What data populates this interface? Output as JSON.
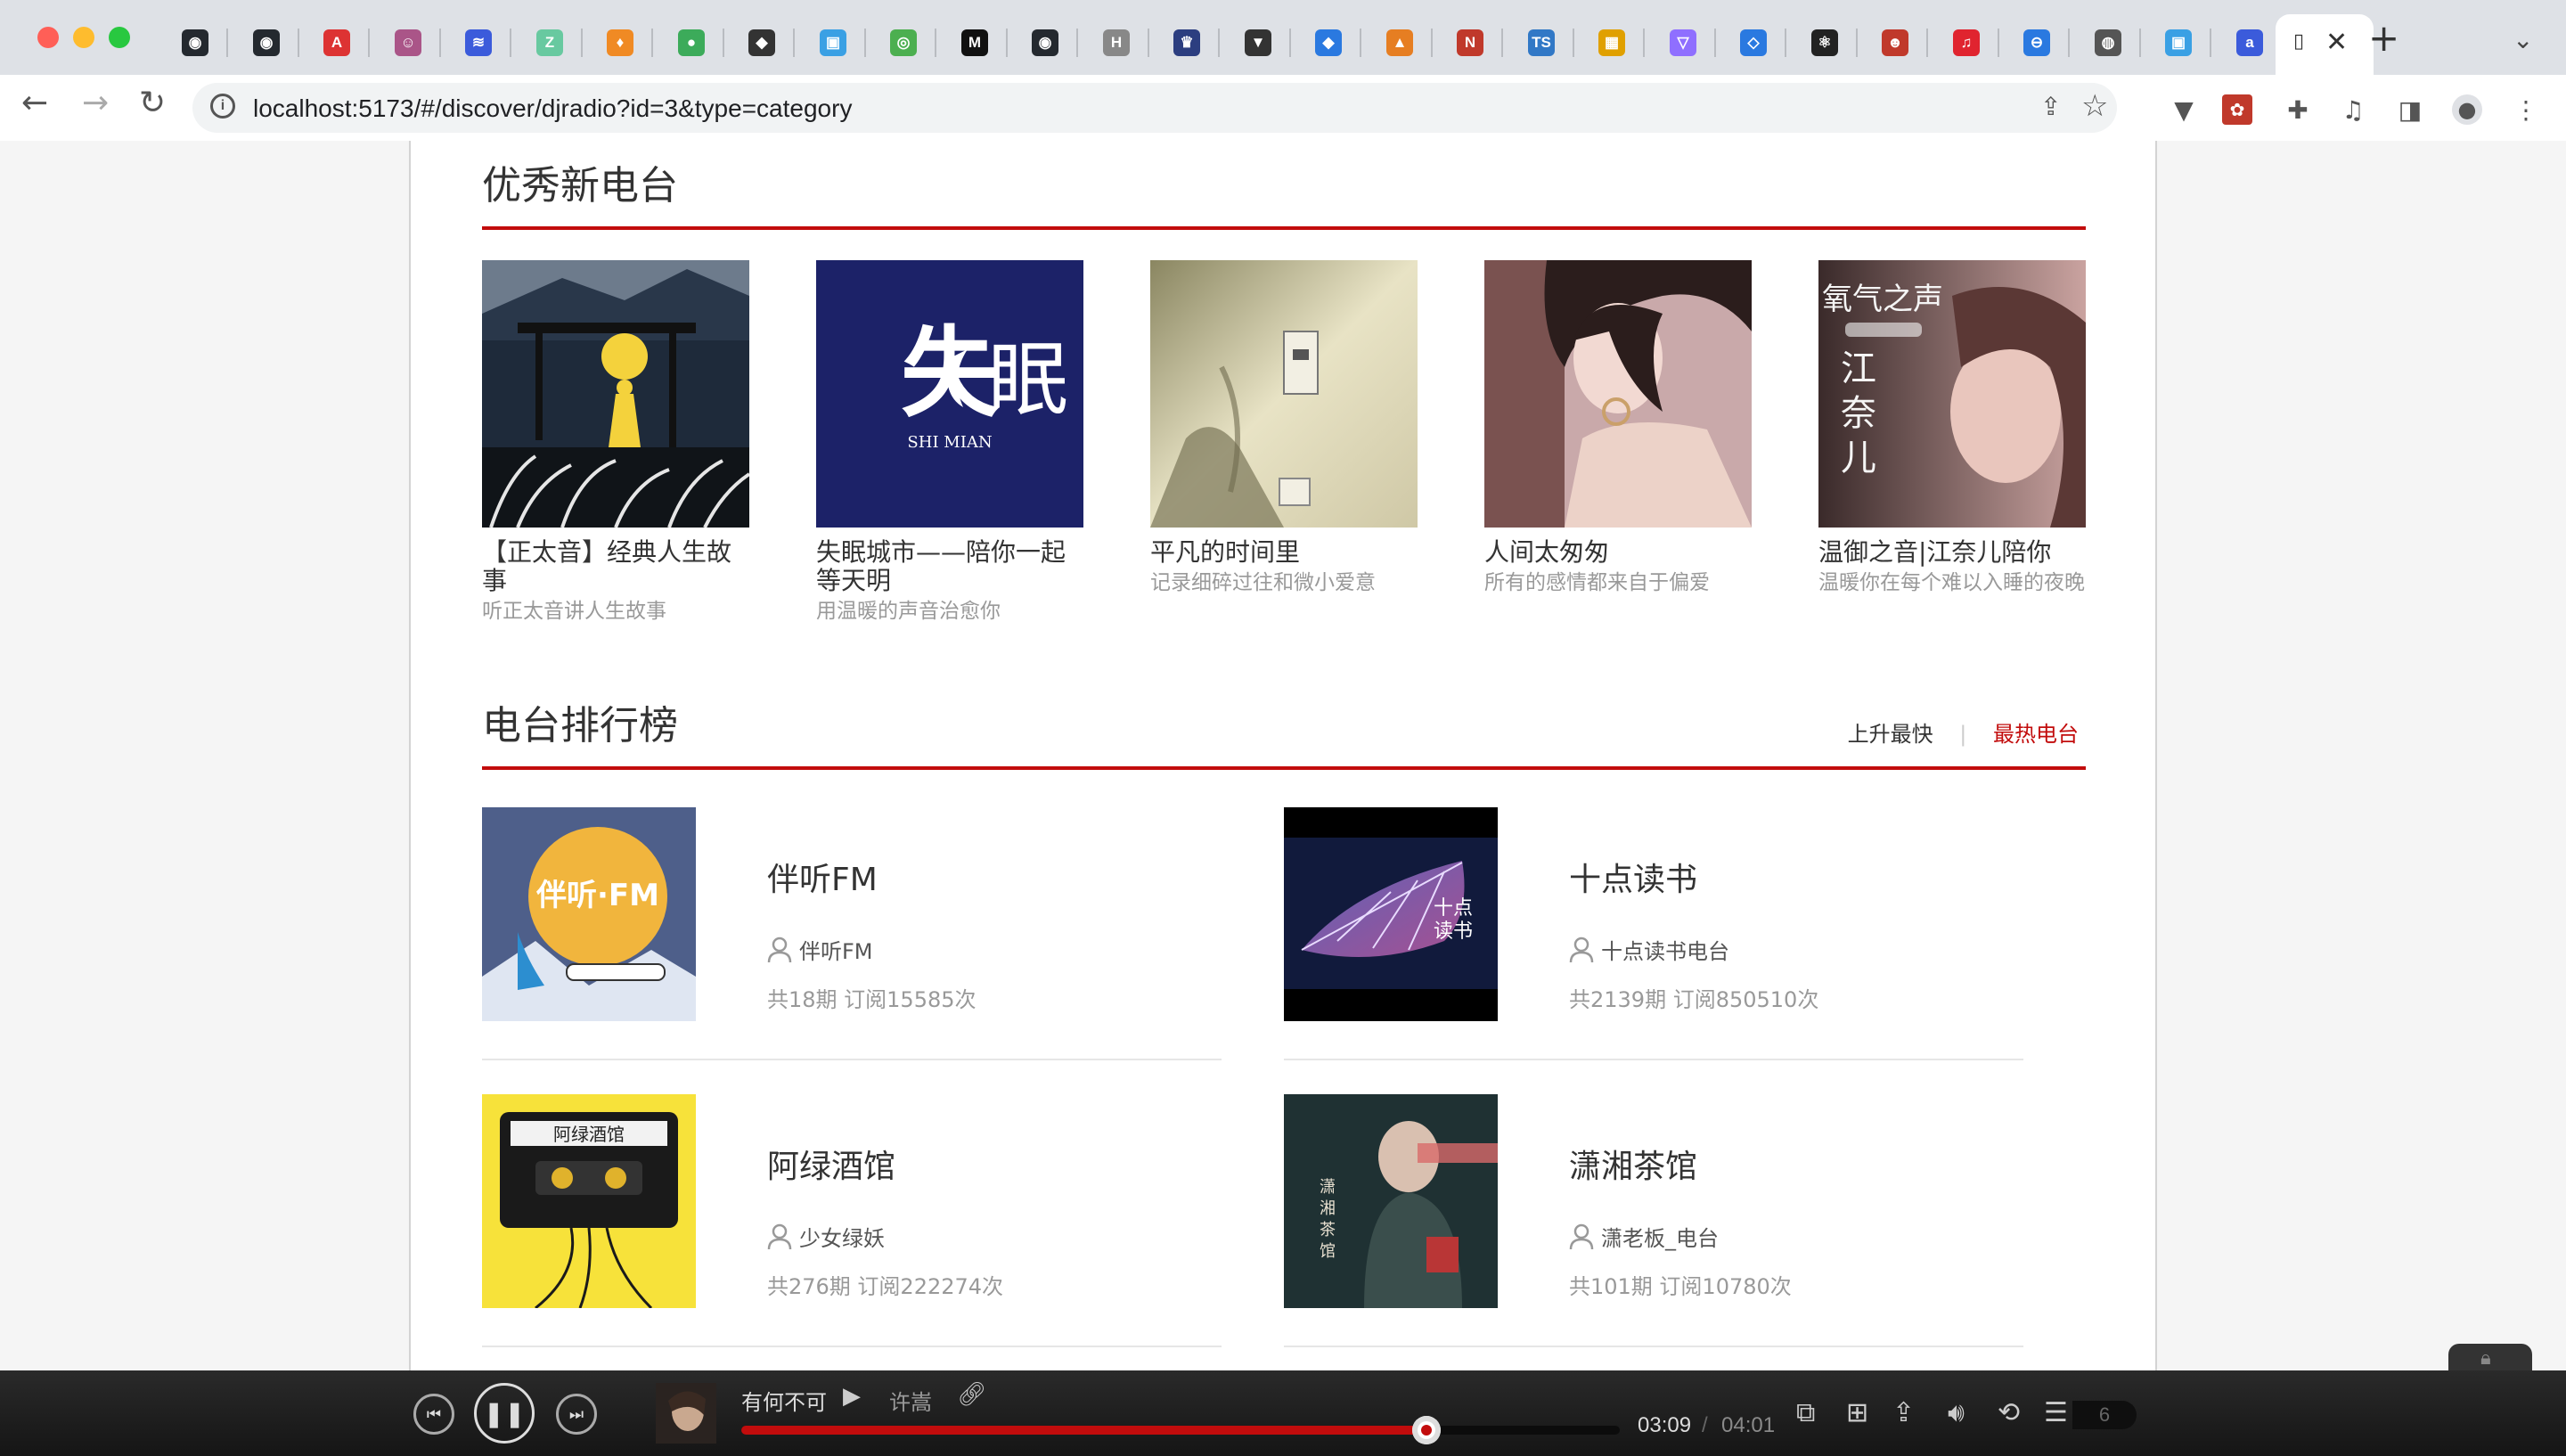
{
  "browser": {
    "url": "localhost:5173/#/discover/djradio?id=3&type=category",
    "active_tab_glyph": "▯",
    "tabs": [
      {
        "icon": "github-icon",
        "glyph": "◉",
        "color": "#24292f"
      },
      {
        "icon": "github-icon",
        "glyph": "◉",
        "color": "#24292f"
      },
      {
        "icon": "a-logo-icon",
        "glyph": "A",
        "color": "#d33"
      },
      {
        "icon": "avatar-icon",
        "glyph": "☺",
        "color": "#a58"
      },
      {
        "icon": "layers-icon",
        "glyph": "≋",
        "color": "#3b5bdb"
      },
      {
        "icon": "z-icon",
        "glyph": "Z",
        "color": "#68c9a0"
      },
      {
        "icon": "lightbulb-icon",
        "glyph": "♦",
        "color": "#f08a24"
      },
      {
        "icon": "leaf-icon",
        "glyph": "●",
        "color": "#3cab5a"
      },
      {
        "icon": "diamond-icon",
        "glyph": "◆",
        "color": "#333"
      },
      {
        "icon": "bilibili-icon",
        "glyph": "▣",
        "color": "#3aa0e4"
      },
      {
        "icon": "chrome-icon",
        "glyph": "◎",
        "color": "#4caf50"
      },
      {
        "icon": "m-icon",
        "glyph": "M",
        "color": "#111"
      },
      {
        "icon": "github-icon",
        "glyph": "◉",
        "color": "#24292f"
      },
      {
        "icon": "h-icon",
        "glyph": "H",
        "color": "#888"
      },
      {
        "icon": "crown-icon",
        "glyph": "♛",
        "color": "#2c3e80"
      },
      {
        "icon": "prism-icon",
        "glyph": "▼",
        "color": "#333"
      },
      {
        "icon": "diamond-blue-icon",
        "glyph": "◆",
        "color": "#2a79e0"
      },
      {
        "icon": "triangle-icon",
        "glyph": "▲",
        "color": "#e67e22"
      },
      {
        "icon": "n-icon",
        "glyph": "N",
        "color": "#c0392b"
      },
      {
        "icon": "ts-icon",
        "glyph": "TS",
        "color": "#3178c6"
      },
      {
        "icon": "grid-icon",
        "glyph": "▦",
        "color": "#e0a000"
      },
      {
        "icon": "vite-icon",
        "glyph": "▽",
        "color": "#8f6fff"
      },
      {
        "icon": "diamond-outline-icon",
        "glyph": "◇",
        "color": "#2a79e0"
      },
      {
        "icon": "react-icon",
        "glyph": "⚛",
        "color": "#222"
      },
      {
        "icon": "mask-icon",
        "glyph": "☻",
        "color": "#c0392b"
      },
      {
        "icon": "netease-music-icon",
        "glyph": "♫",
        "color": "#e0242f"
      },
      {
        "icon": "minus-circle-icon",
        "glyph": "⊖",
        "color": "#2a79e0"
      },
      {
        "icon": "globe-icon",
        "glyph": "◍",
        "color": "#555"
      },
      {
        "icon": "bilibili-icon",
        "glyph": "▣",
        "color": "#3aa0e4"
      },
      {
        "icon": "a-circle-icon",
        "glyph": "a",
        "color": "#3b5bdb"
      }
    ]
  },
  "page": {
    "recommend_title": "优秀新电台",
    "radios": [
      {
        "name": "【正太音】经典人生故事",
        "desc": "听正太音讲人生故事",
        "theme": "night"
      },
      {
        "name": "失眠城市——陪你一起等天明",
        "desc": "用温暖的声音治愈你",
        "theme": "navy"
      },
      {
        "name": "平凡的时间里",
        "desc": "记录细碎过往和微小爱意",
        "theme": "shadow"
      },
      {
        "name": "人间太匆匆",
        "desc": "所有的感情都来自于偏爱",
        "theme": "portrait"
      },
      {
        "name": "温御之音|江奈儿陪你",
        "desc": "温暖你在每个难以入睡的夜晚",
        "theme": "oxygen"
      }
    ],
    "rank_title": "电台排行榜",
    "rank_tabs": {
      "fast": "上升最快",
      "hot": "最热电台"
    },
    "ranks": [
      {
        "name": "伴听FM",
        "dj": "伴听FM",
        "stats": "共18期 订阅15585次",
        "theme": "moon"
      },
      {
        "name": "十点读书",
        "dj": "十点读书电台",
        "stats": "共2139期 订阅850510次",
        "theme": "leaf"
      },
      {
        "name": "阿绿酒馆",
        "dj": "少女绿妖",
        "stats": "共276期 订阅222274次",
        "theme": "tape"
      },
      {
        "name": "潇湘茶馆",
        "dj": "潇老板_电台",
        "stats": "共101期 订阅10780次",
        "theme": "tea"
      }
    ]
  },
  "player": {
    "song": "有何不可",
    "artist": "许嵩",
    "current": "03:09",
    "total": "04:01",
    "progress": 0.78,
    "playlist_count": "6"
  }
}
